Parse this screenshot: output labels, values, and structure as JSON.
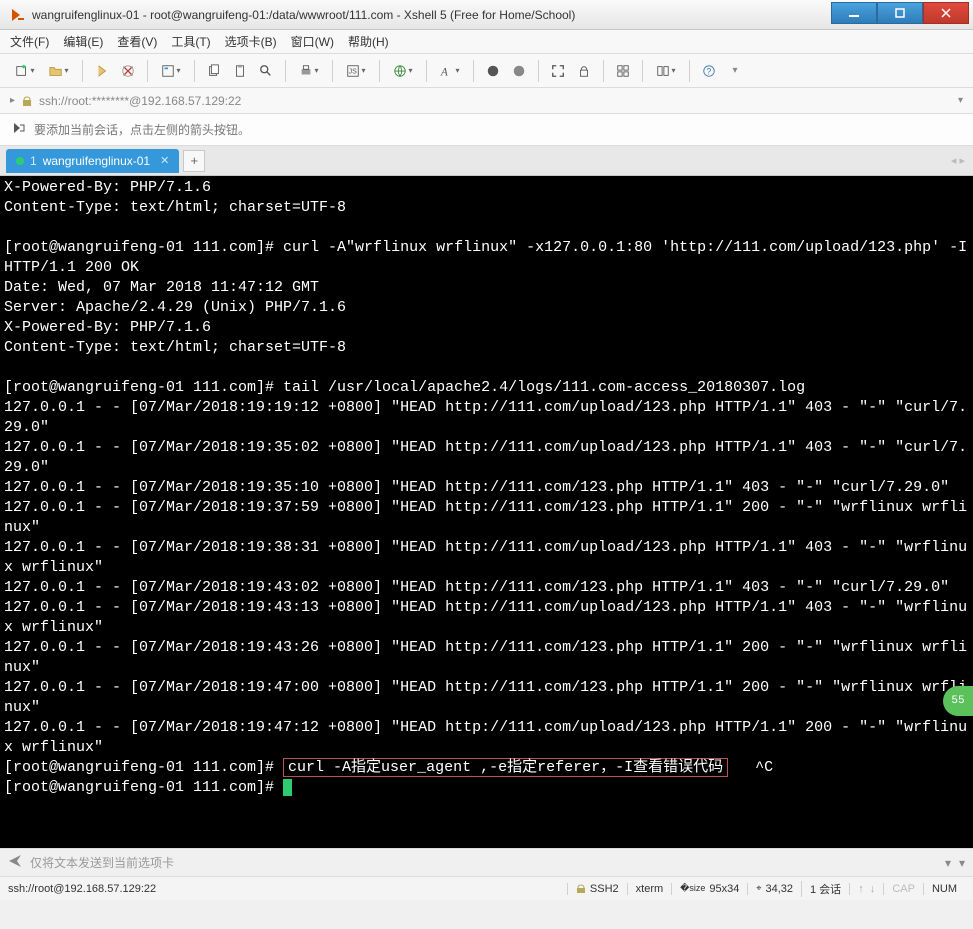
{
  "window": {
    "title": "wangruifenglinux-01 - root@wangruifeng-01:/data/wwwroot/111.com - Xshell 5 (Free for Home/School)"
  },
  "menu": {
    "file": "文件(F)",
    "edit": "编辑(E)",
    "view": "查看(V)",
    "tools": "工具(T)",
    "tabs": "选项卡(B)",
    "window": "窗口(W)",
    "help": "帮助(H)"
  },
  "address": {
    "text": "ssh://root:********@192.168.57.129:22"
  },
  "info": {
    "text": "要添加当前会话，点击左侧的箭头按钮。"
  },
  "tab": {
    "num": "1",
    "label": "wangruifenglinux-01"
  },
  "terminal": {
    "pre": "X-Powered-By: PHP/7.1.6\nContent-Type: text/html; charset=UTF-8\n\n[root@wangruifeng-01 111.com]# curl -A\"wrflinux wrflinux\" -x127.0.0.1:80 'http://111.com/upload/123.php' -I\nHTTP/1.1 200 OK\nDate: Wed, 07 Mar 2018 11:47:12 GMT\nServer: Apache/2.4.29 (Unix) PHP/7.1.6\nX-Powered-By: PHP/7.1.6\nContent-Type: text/html; charset=UTF-8\n\n[root@wangruifeng-01 111.com]# tail /usr/local/apache2.4/logs/111.com-access_20180307.log\n127.0.0.1 - - [07/Mar/2018:19:19:12 +0800] \"HEAD http://111.com/upload/123.php HTTP/1.1\" 403 - \"-\" \"curl/7.29.0\"\n127.0.0.1 - - [07/Mar/2018:19:35:02 +0800] \"HEAD http://111.com/upload/123.php HTTP/1.1\" 403 - \"-\" \"curl/7.29.0\"\n127.0.0.1 - - [07/Mar/2018:19:35:10 +0800] \"HEAD http://111.com/123.php HTTP/1.1\" 403 - \"-\" \"curl/7.29.0\"\n127.0.0.1 - - [07/Mar/2018:19:37:59 +0800] \"HEAD http://111.com/123.php HTTP/1.1\" 200 - \"-\" \"wrflinux wrflinux\"\n127.0.0.1 - - [07/Mar/2018:19:38:31 +0800] \"HEAD http://111.com/upload/123.php HTTP/1.1\" 403 - \"-\" \"wrflinux wrflinux\"\n127.0.0.1 - - [07/Mar/2018:19:43:02 +0800] \"HEAD http://111.com/123.php HTTP/1.1\" 403 - \"-\" \"curl/7.29.0\"\n127.0.0.1 - - [07/Mar/2018:19:43:13 +0800] \"HEAD http://111.com/upload/123.php HTTP/1.1\" 403 - \"-\" \"wrflinux wrflinux\"\n127.0.0.1 - - [07/Mar/2018:19:43:26 +0800] \"HEAD http://111.com/123.php HTTP/1.1\" 200 - \"-\" \"wrflinux wrflinux\"\n127.0.0.1 - - [07/Mar/2018:19:47:00 +0800] \"HEAD http://111.com/123.php HTTP/1.1\" 200 - \"-\" \"wrflinux wrflinux\"\n127.0.0.1 - - [07/Mar/2018:19:47:12 +0800] \"HEAD http://111.com/upload/123.php HTTP/1.1\" 200 - \"-\" \"wrflinux wrflinux\"",
    "prompt1": "[root@wangruifeng-01 111.com]# ",
    "highlight": "curl -A指定user_agent ,-e指定referer，-I查看错误代码",
    "ctrlc": "   ^C",
    "prompt2": "[root@wangruifeng-01 111.com]# ",
    "badge": "55"
  },
  "sendbar": {
    "placeholder": "仅将文本发送到当前选项卡"
  },
  "status": {
    "conn": "ssh://root@192.168.57.129:22",
    "proto": "SSH2",
    "term": "xterm",
    "size": "95x34",
    "pos": "34,32",
    "sessions": "1 会话",
    "cap": "CAP",
    "num": "NUM"
  }
}
